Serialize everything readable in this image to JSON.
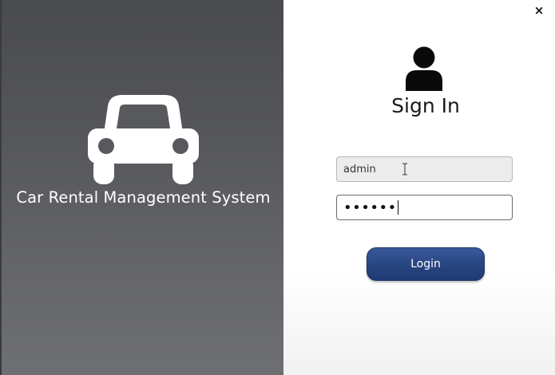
{
  "branding": {
    "app_title": "Car Rental Management System",
    "icon": "car-icon"
  },
  "login_form": {
    "heading": "Sign In",
    "icon": "user-icon",
    "username_value": "admin",
    "password_mask": "••••••",
    "login_label": "Login"
  },
  "window": {
    "close_glyph": "×"
  },
  "colors": {
    "left_panel": "#5a5b5f",
    "button_primary": "#2a4884",
    "text_white": "#ffffff"
  }
}
